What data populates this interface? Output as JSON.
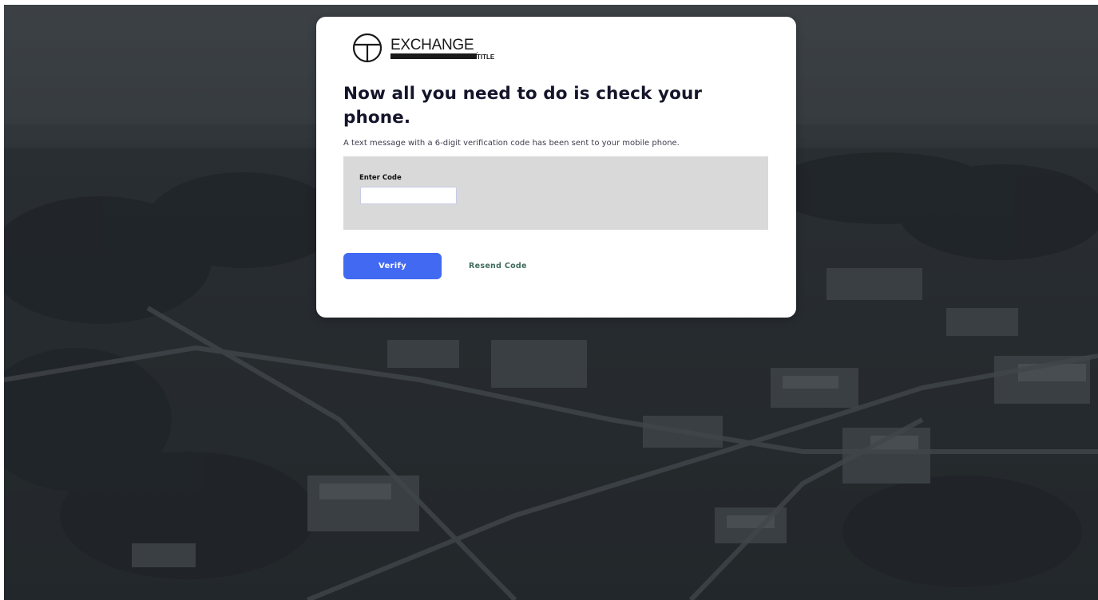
{
  "brand": {
    "logo_word": "EXCHANGE",
    "logo_sub": "TITLE",
    "logo_color": "#1a1a1a"
  },
  "page": {
    "heading": "Now all you need to do is check your phone.",
    "subtext": "A text message with a 6-digit verification code has been sent to your mobile phone."
  },
  "form": {
    "code_label": "Enter Code",
    "code_value": "",
    "panel_color": "#d9d9d9"
  },
  "actions": {
    "verify_label": "Verify",
    "resend_label": "Resend Code",
    "verify_color": "#4169f2",
    "resend_color": "#3f6b5a"
  },
  "background": {
    "description_icon": "aerial-town-photo",
    "tint": "#2f3438"
  }
}
